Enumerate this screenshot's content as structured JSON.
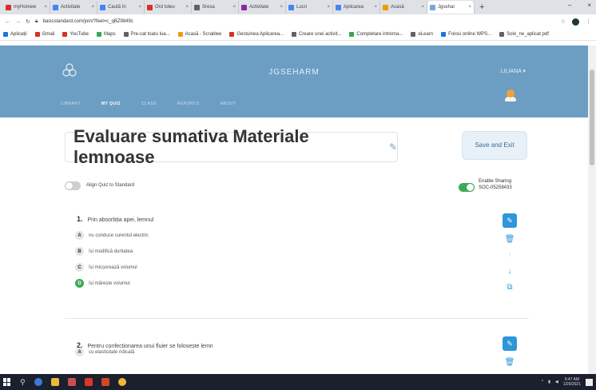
{
  "browser": {
    "tabs": [
      {
        "label": "myHomew",
        "color": "#d93025"
      },
      {
        "label": "Activitate",
        "color": "#4285f4"
      },
      {
        "label": "Caută în",
        "color": "#4285f4"
      },
      {
        "label": "Ord toleu",
        "color": "#d93025"
      },
      {
        "label": "Sresa",
        "color": "#5f6368"
      },
      {
        "label": "Activitate",
        "color": "#8e24aa"
      },
      {
        "label": "Lucri",
        "color": "#4285f4"
      },
      {
        "label": "Aplicarea",
        "color": "#4285f4"
      },
      {
        "label": "Acasă",
        "color": "#f29900"
      },
      {
        "label": "Jgsehar",
        "color": "#7aa7d6",
        "active": true
      }
    ],
    "new_tab": "+",
    "window_controls": [
      "–",
      "×"
    ],
    "url": "basicstandard.com/join/?feel=c_qBZ9849c",
    "bookmarks": [
      {
        "label": "Aplicații",
        "color": "#1a73e8"
      },
      {
        "label": "Gmail",
        "color": "#d93025"
      },
      {
        "label": "YouTube",
        "color": "#d93025"
      },
      {
        "label": "Maps",
        "color": "#34a853"
      },
      {
        "label": "Pre-cat toatu lua...",
        "color": "#5f6368"
      },
      {
        "label": "Acasă - Scrablee",
        "color": "#f29900"
      },
      {
        "label": "Gestuinea Aplicarea...",
        "color": "#d93025"
      },
      {
        "label": "Creare unei activit...",
        "color": "#5f6368"
      },
      {
        "label": "Completare intrerna...",
        "color": "#34a853"
      },
      {
        "label": "eLearn",
        "color": "#5f6368"
      },
      {
        "label": "Folosi online WPS...",
        "color": "#1a73e8"
      },
      {
        "label": "Solo_ne_aplicat pdf",
        "color": "#5f6368"
      }
    ]
  },
  "app": {
    "brand": "JGSEHARM",
    "user": "LILIANA ▾",
    "nav": [
      {
        "label": "LIBRARY",
        "active": false
      },
      {
        "label": "MY QUIZ",
        "active": true
      },
      {
        "label": "CLASS",
        "active": false
      },
      {
        "label": "REPORTS",
        "active": false
      },
      {
        "label": "ABOUT",
        "active": false
      }
    ]
  },
  "quiz": {
    "title": "Evaluare sumativa Materiale lemnoase",
    "save_label": "Save and Exit",
    "align_label": "Align Quiz to Standard",
    "sharing_label": "Enable Sharing",
    "sharing_code": "SOC-05258433",
    "questions": [
      {
        "number": "1.",
        "text": "Prin absorbția apei, lemnul",
        "options": [
          {
            "letter": "A",
            "text": "nu conduce curentul electric",
            "correct": false
          },
          {
            "letter": "B",
            "text": "își modifică duritatea",
            "correct": false
          },
          {
            "letter": "C",
            "text": "își micșorează volumul",
            "correct": false
          },
          {
            "letter": "D",
            "text": "își mărește volumul",
            "correct": true
          }
        ]
      },
      {
        "number": "2.",
        "text": "Pentru confecționarea unui fluier se folosește lemn",
        "options": [
          {
            "letter": "A",
            "text": "cu elasticitate ridicată",
            "correct": false
          }
        ]
      }
    ]
  },
  "taskbar": {
    "time": "9:47 AM",
    "date": "1/26/2021"
  }
}
